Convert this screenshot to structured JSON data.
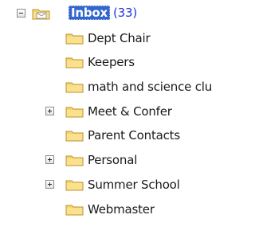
{
  "tree": {
    "inbox": {
      "label": "Inbox",
      "count": "(33)",
      "expander": "minus"
    },
    "children": [
      {
        "label": "Dept Chair"
      },
      {
        "label": "Keepers"
      },
      {
        "label": "math and science clu"
      },
      {
        "label": "Meet & Confer",
        "expander": "plus"
      },
      {
        "label": "Parent Contacts"
      },
      {
        "label": "Personal",
        "expander": "plus"
      },
      {
        "label": "Summer School",
        "expander": "plus"
      },
      {
        "label": "Webmaster"
      }
    ]
  },
  "colors": {
    "selection": "#3366cc",
    "count": "#1f38d6",
    "folder_fill": "#f6d56b",
    "folder_edge": "#b89433"
  },
  "icons": {
    "expander_minus": "collapse-minus-icon",
    "expander_plus": "expand-plus-icon",
    "inbox_folder": "inbox-folder-icon",
    "folder": "folder-icon"
  }
}
